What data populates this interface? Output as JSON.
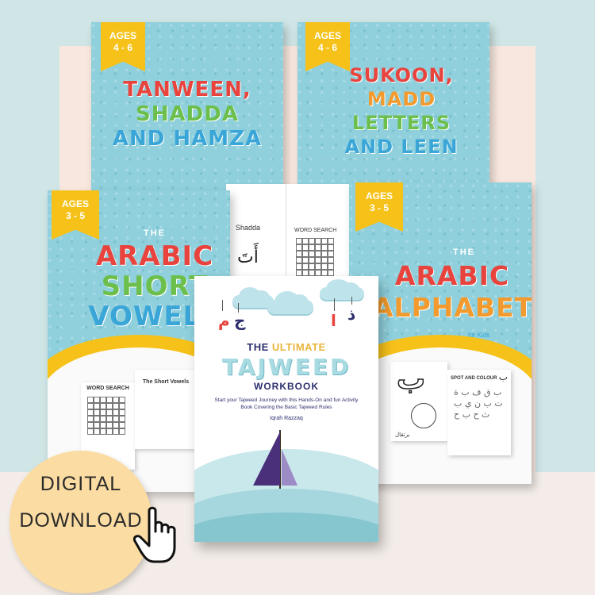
{
  "books": {
    "tanween": {
      "ages": [
        "AGES",
        "4 - 6"
      ],
      "title_lines": [
        "TANWEEN,",
        "SHADDA",
        "AND HAMZA"
      ]
    },
    "sukoon": {
      "ages": [
        "AGES",
        "4 - 6"
      ],
      "title_lines": [
        "SUKOON,",
        "MADD",
        "LETTERS",
        "AND LEEN"
      ]
    },
    "short_vowels": {
      "ages": [
        "AGES",
        "3 - 5"
      ],
      "the": "THE",
      "title_lines": [
        "ARABIC",
        "SHORT",
        "VOWELS"
      ]
    },
    "alphabet": {
      "ages": [
        "AGES",
        "3 - 5"
      ],
      "the": "THE",
      "title_lines": [
        "ARABIC",
        "ALPHABET"
      ],
      "for_kids": "for Kids"
    }
  },
  "spread": {
    "left_title": "Shadda",
    "left_glyph": "أَتَ",
    "right_title": "WORD SEARCH"
  },
  "pages": {
    "word_search": "WORD SEARCH",
    "short_vowels": "The Short Vowels",
    "alphabet_letter": "ب",
    "spot": "SPOT AND COLOUR",
    "spot_letter": "ب",
    "caption": "برتقال"
  },
  "main_book": {
    "letters": [
      "م",
      "ج",
      "ا",
      "ذ"
    ],
    "the": "THE",
    "ultimate": "ULTIMATE",
    "tajweed": "TAJWEED",
    "workbook": "WORKBOOK",
    "subtitle": "Start your Tajweed Journey with this Hands-On and fun Activity Book Covering the Basic Tajweed Rules",
    "author": "Iqrah Razzaq"
  },
  "badge": {
    "line1": "DIGITAL",
    "line2": "DOWNLOAD"
  },
  "icons": [
    "pointing-hand-icon"
  ],
  "colors": {
    "cover": "#8fd0dc",
    "accent": "#f6c21a",
    "navy": "#2e2f6e",
    "badge": "#fbdca2"
  }
}
